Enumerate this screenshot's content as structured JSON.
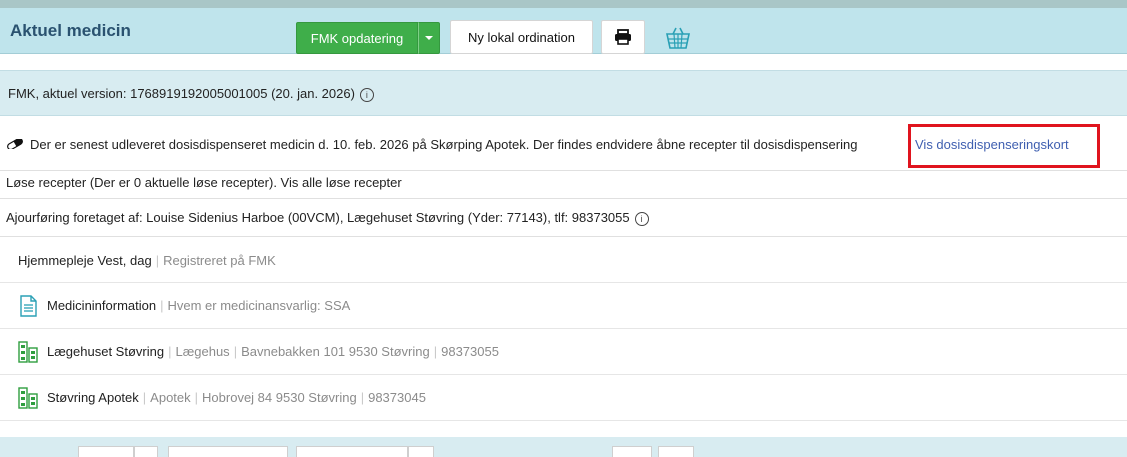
{
  "header": {
    "title": "Aktuel medicin",
    "fmk_button_label": "FMK opdatering",
    "ny_lokal_label": "Ny lokal ordination"
  },
  "fmk_version": {
    "text": "FMK, aktuel version: 1768919192005001005 (20. jan. 2026)"
  },
  "dosis": {
    "text": "Der er senest udleveret dosisdispenseret medicin d. 10. feb. 2026 på Skørping Apotek. Der findes endvidere åbne recepter til dosisdispensering",
    "link_label": "Vis dosisdispenseringskort"
  },
  "loese_recepter": {
    "text": "Løse recepter (Der er 0 aktuelle løse recepter). Vis alle løse recepter"
  },
  "ajourfoering": {
    "text": "Ajourføring foretaget af: Louise Sidenius Harboe (00VCM), Lægehuset Støvring (Yder: 77143), tlf: 98373055"
  },
  "entities": {
    "hjemmepleje": {
      "name": "Hjemmepleje Vest, dag",
      "detail": "Registreret på FMK"
    },
    "medicininfo": {
      "name": "Medicininformation",
      "detail": "Hvem er medicinansvarlig: SSA"
    },
    "laegehus": {
      "name": "Lægehuset Støvring",
      "type": "Lægehus",
      "address": "Bavnebakken 101 9530 Støvring",
      "phone": "98373055"
    },
    "apotek": {
      "name": "Støvring Apotek",
      "type": "Apotek",
      "address": "Hobrovej 84 9530 Støvring",
      "phone": "98373045"
    }
  },
  "icons": {
    "info": "info-circle-icon",
    "print": "printer-icon",
    "basket": "basket-icon",
    "pill": "pill-icon",
    "document": "document-icon",
    "organization": "organization-icon"
  },
  "colors": {
    "header_bg": "#bfe4ec",
    "title": "#2a5270",
    "green_button": "#3fae4a",
    "link": "#3f5fb0",
    "highlight_border": "#e0141e",
    "info_row_bg": "#d8ecf1",
    "icon_green": "#2f9e3f",
    "icon_teal": "#2aa0b5"
  }
}
